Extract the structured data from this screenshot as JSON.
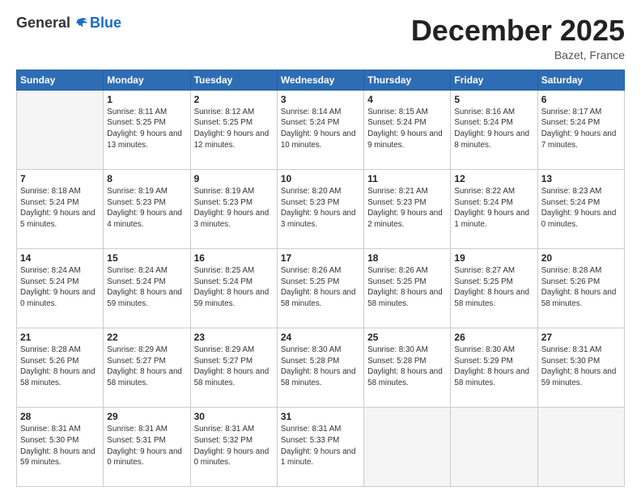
{
  "logo": {
    "general": "General",
    "blue": "Blue"
  },
  "header": {
    "month": "December 2025",
    "location": "Bazet, France"
  },
  "weekdays": [
    "Sunday",
    "Monday",
    "Tuesday",
    "Wednesday",
    "Thursday",
    "Friday",
    "Saturday"
  ],
  "weeks": [
    [
      {
        "day": "",
        "empty": true
      },
      {
        "day": "1",
        "sunrise": "Sunrise: 8:11 AM",
        "sunset": "Sunset: 5:25 PM",
        "daylight": "Daylight: 9 hours and 13 minutes."
      },
      {
        "day": "2",
        "sunrise": "Sunrise: 8:12 AM",
        "sunset": "Sunset: 5:25 PM",
        "daylight": "Daylight: 9 hours and 12 minutes."
      },
      {
        "day": "3",
        "sunrise": "Sunrise: 8:14 AM",
        "sunset": "Sunset: 5:24 PM",
        "daylight": "Daylight: 9 hours and 10 minutes."
      },
      {
        "day": "4",
        "sunrise": "Sunrise: 8:15 AM",
        "sunset": "Sunset: 5:24 PM",
        "daylight": "Daylight: 9 hours and 9 minutes."
      },
      {
        "day": "5",
        "sunrise": "Sunrise: 8:16 AM",
        "sunset": "Sunset: 5:24 PM",
        "daylight": "Daylight: 9 hours and 8 minutes."
      },
      {
        "day": "6",
        "sunrise": "Sunrise: 8:17 AM",
        "sunset": "Sunset: 5:24 PM",
        "daylight": "Daylight: 9 hours and 7 minutes."
      }
    ],
    [
      {
        "day": "7",
        "sunrise": "Sunrise: 8:18 AM",
        "sunset": "Sunset: 5:24 PM",
        "daylight": "Daylight: 9 hours and 5 minutes."
      },
      {
        "day": "8",
        "sunrise": "Sunrise: 8:19 AM",
        "sunset": "Sunset: 5:23 PM",
        "daylight": "Daylight: 9 hours and 4 minutes."
      },
      {
        "day": "9",
        "sunrise": "Sunrise: 8:19 AM",
        "sunset": "Sunset: 5:23 PM",
        "daylight": "Daylight: 9 hours and 3 minutes."
      },
      {
        "day": "10",
        "sunrise": "Sunrise: 8:20 AM",
        "sunset": "Sunset: 5:23 PM",
        "daylight": "Daylight: 9 hours and 3 minutes."
      },
      {
        "day": "11",
        "sunrise": "Sunrise: 8:21 AM",
        "sunset": "Sunset: 5:23 PM",
        "daylight": "Daylight: 9 hours and 2 minutes."
      },
      {
        "day": "12",
        "sunrise": "Sunrise: 8:22 AM",
        "sunset": "Sunset: 5:24 PM",
        "daylight": "Daylight: 9 hours and 1 minute."
      },
      {
        "day": "13",
        "sunrise": "Sunrise: 8:23 AM",
        "sunset": "Sunset: 5:24 PM",
        "daylight": "Daylight: 9 hours and 0 minutes."
      }
    ],
    [
      {
        "day": "14",
        "sunrise": "Sunrise: 8:24 AM",
        "sunset": "Sunset: 5:24 PM",
        "daylight": "Daylight: 9 hours and 0 minutes."
      },
      {
        "day": "15",
        "sunrise": "Sunrise: 8:24 AM",
        "sunset": "Sunset: 5:24 PM",
        "daylight": "Daylight: 8 hours and 59 minutes."
      },
      {
        "day": "16",
        "sunrise": "Sunrise: 8:25 AM",
        "sunset": "Sunset: 5:24 PM",
        "daylight": "Daylight: 8 hours and 59 minutes."
      },
      {
        "day": "17",
        "sunrise": "Sunrise: 8:26 AM",
        "sunset": "Sunset: 5:25 PM",
        "daylight": "Daylight: 8 hours and 58 minutes."
      },
      {
        "day": "18",
        "sunrise": "Sunrise: 8:26 AM",
        "sunset": "Sunset: 5:25 PM",
        "daylight": "Daylight: 8 hours and 58 minutes."
      },
      {
        "day": "19",
        "sunrise": "Sunrise: 8:27 AM",
        "sunset": "Sunset: 5:25 PM",
        "daylight": "Daylight: 8 hours and 58 minutes."
      },
      {
        "day": "20",
        "sunrise": "Sunrise: 8:28 AM",
        "sunset": "Sunset: 5:26 PM",
        "daylight": "Daylight: 8 hours and 58 minutes."
      }
    ],
    [
      {
        "day": "21",
        "sunrise": "Sunrise: 8:28 AM",
        "sunset": "Sunset: 5:26 PM",
        "daylight": "Daylight: 8 hours and 58 minutes."
      },
      {
        "day": "22",
        "sunrise": "Sunrise: 8:29 AM",
        "sunset": "Sunset: 5:27 PM",
        "daylight": "Daylight: 8 hours and 58 minutes."
      },
      {
        "day": "23",
        "sunrise": "Sunrise: 8:29 AM",
        "sunset": "Sunset: 5:27 PM",
        "daylight": "Daylight: 8 hours and 58 minutes."
      },
      {
        "day": "24",
        "sunrise": "Sunrise: 8:30 AM",
        "sunset": "Sunset: 5:28 PM",
        "daylight": "Daylight: 8 hours and 58 minutes."
      },
      {
        "day": "25",
        "sunrise": "Sunrise: 8:30 AM",
        "sunset": "Sunset: 5:28 PM",
        "daylight": "Daylight: 8 hours and 58 minutes."
      },
      {
        "day": "26",
        "sunrise": "Sunrise: 8:30 AM",
        "sunset": "Sunset: 5:29 PM",
        "daylight": "Daylight: 8 hours and 58 minutes."
      },
      {
        "day": "27",
        "sunrise": "Sunrise: 8:31 AM",
        "sunset": "Sunset: 5:30 PM",
        "daylight": "Daylight: 8 hours and 59 minutes."
      }
    ],
    [
      {
        "day": "28",
        "sunrise": "Sunrise: 8:31 AM",
        "sunset": "Sunset: 5:30 PM",
        "daylight": "Daylight: 8 hours and 59 minutes."
      },
      {
        "day": "29",
        "sunrise": "Sunrise: 8:31 AM",
        "sunset": "Sunset: 5:31 PM",
        "daylight": "Daylight: 9 hours and 0 minutes."
      },
      {
        "day": "30",
        "sunrise": "Sunrise: 8:31 AM",
        "sunset": "Sunset: 5:32 PM",
        "daylight": "Daylight: 9 hours and 0 minutes."
      },
      {
        "day": "31",
        "sunrise": "Sunrise: 8:31 AM",
        "sunset": "Sunset: 5:33 PM",
        "daylight": "Daylight: 9 hours and 1 minute."
      },
      {
        "day": "",
        "empty": true
      },
      {
        "day": "",
        "empty": true
      },
      {
        "day": "",
        "empty": true
      }
    ]
  ]
}
